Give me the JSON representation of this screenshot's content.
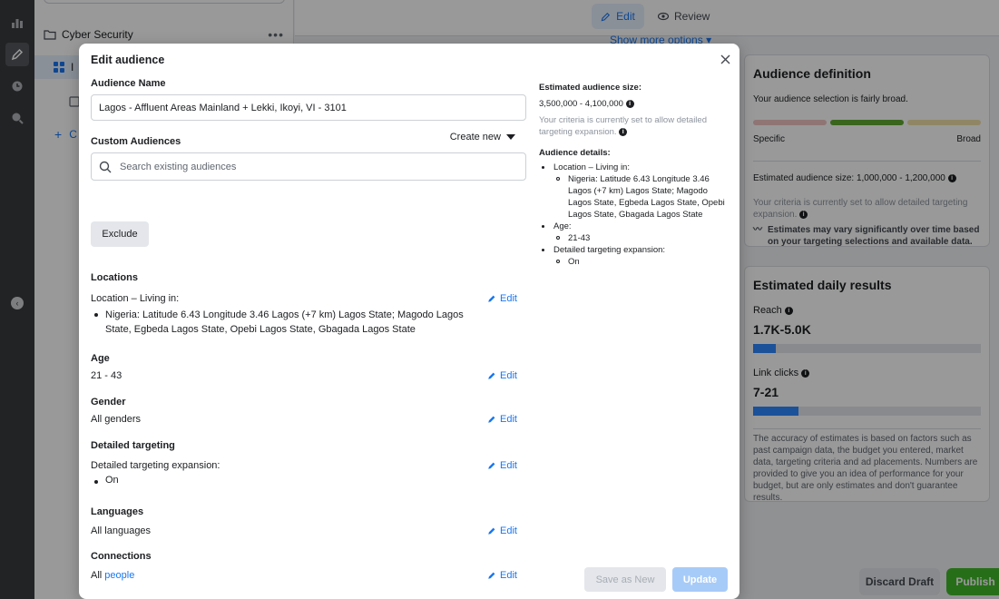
{
  "nav": {
    "folder_label": "Cyber Security",
    "selected_prefix": "I",
    "create_prefix": "C"
  },
  "topbar": {
    "edit_tab": "Edit",
    "review_tab": "Review",
    "show_more": "Show more options"
  },
  "side_panel": {
    "definition": {
      "title": "Audience definition",
      "status_text": "Your audience selection is fairly broad.",
      "specific_label": "Specific",
      "broad_label": "Broad",
      "meter_colors": [
        "#f0c4c4",
        "#5fa831",
        "#f1e0a8"
      ],
      "estimated_size": "Estimated audience size: 1,000,000 - 1,200,000",
      "criteria_note": "Your criteria is currently set to allow detailed targeting expansion.",
      "variance_note": "Estimates may vary significantly over time based on your targeting selections and available data."
    },
    "daily_results": {
      "title": "Estimated daily results",
      "reach_label": "Reach",
      "reach_value": "1.7K-5.0K",
      "reach_fill": 0.1,
      "link_clicks_label": "Link clicks",
      "link_clicks_value": "7-21",
      "link_clicks_fill": 0.2,
      "disclaimer": "The accuracy of estimates is based on factors such as past campaign data, the budget you entered, market data, targeting criteria and ad placements. Numbers are provided to give you an idea of performance for your budget, but are only estimates and don't guarantee results."
    },
    "discard_label": "Discard Draft",
    "publish_label": "Publish"
  },
  "modal": {
    "title": "Edit audience",
    "audience_name_label": "Audience Name",
    "audience_name_value": "Lagos - Affluent Areas Mainland + Lekki, Ikoyi, VI - 3101",
    "custom_audiences_label": "Custom Audiences",
    "create_new_label": "Create new",
    "search_placeholder": "Search existing audiences",
    "exclude_label": "Exclude",
    "edit_label": "Edit",
    "locations": {
      "heading": "Locations",
      "sub": "Location – Living in:",
      "value": "Nigeria: Latitude 6.43 Longitude 3.46 Lagos (+7 km) Lagos State; Magodo Lagos State, Egbeda Lagos State, Opebi Lagos State, Gbagada Lagos State"
    },
    "age": {
      "heading": "Age",
      "value": "21 - 43"
    },
    "gender": {
      "heading": "Gender",
      "value": "All genders"
    },
    "detailed": {
      "heading": "Detailed targeting",
      "sub": "Detailed targeting expansion:",
      "value": "On"
    },
    "languages": {
      "heading": "Languages",
      "value": "All languages"
    },
    "connections": {
      "heading": "Connections",
      "prefix": "All",
      "link": "people"
    },
    "summary": {
      "size_label": "Estimated audience size:",
      "size_value": "3,500,000 - 4,100,000",
      "criteria_note": "Your criteria is currently set to allow detailed targeting expansion.",
      "details_label": "Audience details:",
      "location_item": "Location – Living in:",
      "location_value": "Nigeria: Latitude 6.43 Longitude 3.46 Lagos (+7 km) Lagos State; Magodo Lagos State, Egbeda Lagos State, Opebi Lagos State, Gbagada Lagos State",
      "age_item": "Age:",
      "age_value": "21-43",
      "expansion_item": "Detailed targeting expansion:",
      "expansion_value": "On"
    },
    "save_as_new_label": "Save as New",
    "update_label": "Update"
  }
}
